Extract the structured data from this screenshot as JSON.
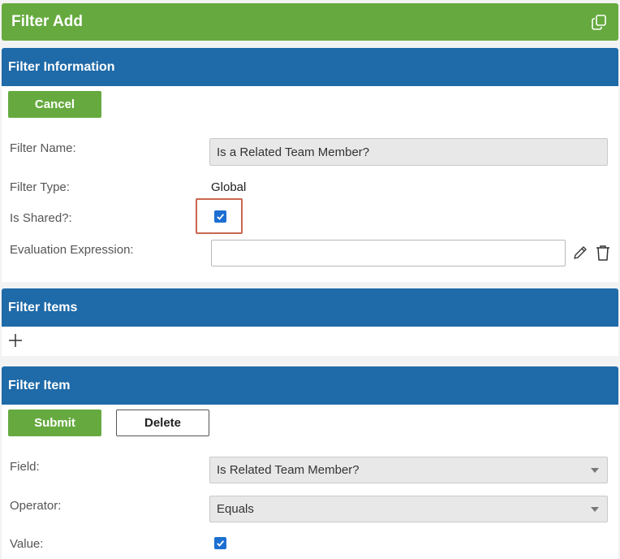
{
  "header": {
    "title": "Filter Add",
    "copy_icon": "copy-icon"
  },
  "filter_information": {
    "title": "Filter Information",
    "cancel_label": "Cancel",
    "filter_name_label": "Filter Name:",
    "filter_name_value": "Is a Related Team Member?",
    "filter_type_label": "Filter Type:",
    "filter_type_value": "Global",
    "is_shared_label": "Is Shared?:",
    "is_shared_checked": true,
    "evaluation_expression_label": "Evaluation Expression:",
    "evaluation_expression_value": "",
    "edit_icon": "pencil-icon",
    "delete_icon": "trash-icon"
  },
  "filter_items": {
    "title": "Filter Items",
    "add_icon": "plus-icon"
  },
  "filter_item": {
    "title": "Filter Item",
    "submit_label": "Submit",
    "delete_label": "Delete",
    "field_label": "Field:",
    "field_value": "Is Related Team Member?",
    "operator_label": "Operator:",
    "operator_value": "Equals",
    "value_label": "Value:",
    "value_checked": true
  },
  "colors": {
    "header_green": "#66aa3f",
    "section_blue": "#1f6aa8",
    "checkbox_blue": "#1d6fd1",
    "highlight": "#c8664f"
  }
}
